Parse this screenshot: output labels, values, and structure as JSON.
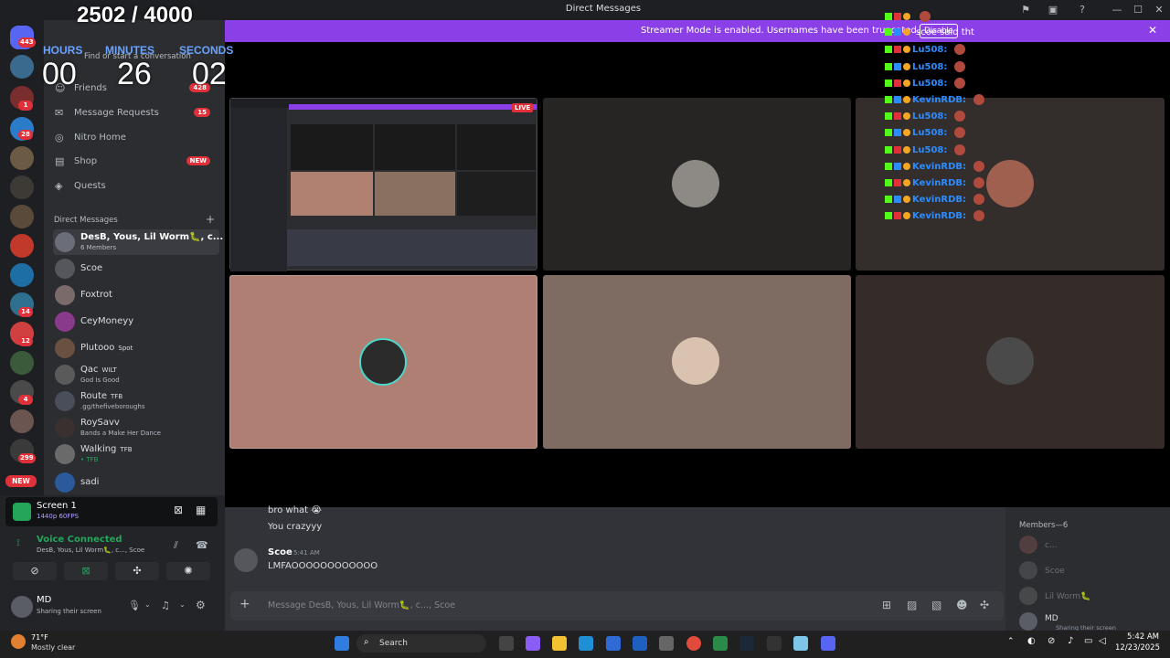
{
  "window": {
    "title": "Direct Messages"
  },
  "banner": {
    "text": "Streamer Mode is enabled. Usernames have been truncated.",
    "button": "Disable"
  },
  "overlay": {
    "counter": "2502 / 4000",
    "timer": {
      "hours_label": "HOURS",
      "minutes_label": "MINUTES",
      "seconds_label": "SECONDS",
      "hours": "00",
      "minutes": "26",
      "seconds": "02"
    }
  },
  "rail": {
    "badges": [
      "443",
      "1",
      "28",
      "14",
      "12",
      "4",
      "299",
      "NEW"
    ]
  },
  "sidebar": {
    "search_placeholder": "Find or start a conversation",
    "friends": "Friends",
    "friends_badge": "428",
    "message_requests": "Message Requests",
    "message_requests_badge": "15",
    "nitro_home": "Nitro Home",
    "shop": "Shop",
    "shop_badge": "NEW",
    "quests": "Quests",
    "dm_header": "Direct Messages",
    "dms": [
      {
        "name": "DesB, Yous, Lil Worm🐛, c...",
        "sub": "6 Members",
        "tag": ""
      },
      {
        "name": "Scoe",
        "sub": "",
        "tag": ""
      },
      {
        "name": "Foxtrot",
        "sub": "",
        "tag": ""
      },
      {
        "name": "CeyMoneyy",
        "sub": "",
        "tag": ""
      },
      {
        "name": "Plutooo",
        "sub": "",
        "tag": "Spot"
      },
      {
        "name": "Qac",
        "sub": "God Is Good",
        "tag": "WILT"
      },
      {
        "name": "Route",
        "sub": ".gg/thefiveboroughs",
        "tag": "TFB"
      },
      {
        "name": "RoySavv",
        "sub": "Bands a Make Her Dance",
        "tag": ""
      },
      {
        "name": "Walking",
        "sub": "• TFB",
        "tag": "TFB"
      },
      {
        "name": "sadi",
        "sub": "",
        "tag": ""
      }
    ]
  },
  "screen_share": {
    "title": "Screen 1",
    "sub": "1440p 60FPS"
  },
  "voice": {
    "status": "Voice Connected",
    "channel": "DesB, Yous, Lil Worm🐛, c..., Scoe"
  },
  "user": {
    "name": "MD",
    "status": "Sharing their screen"
  },
  "stream": {
    "live_label": "LIVE"
  },
  "chat": {
    "messages": [
      {
        "text": "bro what 😭"
      },
      {
        "text": "You crazyyy"
      }
    ],
    "last_author": "Scoe",
    "last_time": "5:41 AM",
    "last_text": "LMFAOOOOOOOOOOOO",
    "input_placeholder": "Message DesB, Yous, Lil Worm🐛, c..., Scoe"
  },
  "members": {
    "header": "Members—6",
    "list": [
      {
        "name": "c...",
        "sub": ""
      },
      {
        "name": "Scoe",
        "sub": ""
      },
      {
        "name": "Lil Worm🐛",
        "sub": ""
      },
      {
        "name": "MD",
        "sub": "Sharing their screen"
      }
    ]
  },
  "stream_chat": [
    {
      "who": "",
      "msg": "",
      "color": "#e0313a"
    },
    {
      "who": "",
      "msg": "scoe said tht",
      "color": "#ffffff"
    },
    {
      "who": "Lu508:",
      "msg": "",
      "color": "#2c8cff"
    },
    {
      "who": "Lu508:",
      "msg": "",
      "color": "#2c8cff"
    },
    {
      "who": "Lu508:",
      "msg": "",
      "color": "#2c8cff"
    },
    {
      "who": "KevinRDB:",
      "msg": "",
      "color": "#2c8cff"
    },
    {
      "who": "Lu508:",
      "msg": "",
      "color": "#2c8cff"
    },
    {
      "who": "Lu508:",
      "msg": "",
      "color": "#2c8cff"
    },
    {
      "who": "Lu508:",
      "msg": "",
      "color": "#2c8cff"
    },
    {
      "who": "KevinRDB:",
      "msg": "",
      "color": "#2c8cff"
    },
    {
      "who": "KevinRDB:",
      "msg": "",
      "color": "#2c8cff"
    },
    {
      "who": "KevinRDB:",
      "msg": "",
      "color": "#2c8cff"
    },
    {
      "who": "KevinRDB:",
      "msg": "",
      "color": "#2c8cff"
    }
  ],
  "taskbar": {
    "weather_temp": "71°F",
    "weather_desc": "Mostly clear",
    "search": "Search",
    "time": "5:42 AM",
    "date": "12/23/2025"
  }
}
